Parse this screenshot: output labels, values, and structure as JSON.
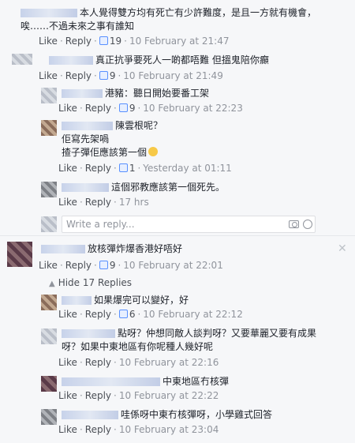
{
  "actions": {
    "like": "Like",
    "reply": "Reply",
    "sep": "·"
  },
  "comments": [
    {
      "text": "本人覺得雙方均有死亡有少許難度，是且一方就有機會，唉……不過未來之事有誰知",
      "likes": "19",
      "time": "10 February at 21:47"
    },
    {
      "text": "真正抗爭要死人一啲都唔難 但搵鬼陪你癲",
      "likes": "9",
      "time": "10 February at 21:49"
    },
    {
      "text": "港豬：聽日開始要番工架",
      "likes": "9",
      "time": "10 February at 22:23"
    },
    {
      "text_lines": [
        "陳雲根呢？",
        "佢寫先架喎",
        "揸子彈佢應該第一個"
      ],
      "likes": "1",
      "time": "Yesterday at 01:11"
    },
    {
      "text": "這個邪教應該第一個死先。",
      "time": "17 hrs"
    },
    {
      "text": "放核彈炸爆香港好唔好",
      "likes": "9",
      "time": "10 February at 22:01"
    },
    {
      "text": "如果爆完可以變好，好",
      "likes": "6",
      "time": "10 February at 22:12"
    },
    {
      "text_lines": [
        "點呀？仲想同敵人談判呀？又要華麗又要有成果",
        "呀？如果中東地區有你呢種人幾好呢"
      ],
      "time": "10 February at 22:16"
    },
    {
      "text": "中東地區冇核彈",
      "time": "10 February at 22:22"
    },
    {
      "text": "哇係呀中東冇核彈呀，小學雞式回答",
      "time": "10 February at 23:04"
    }
  ],
  "reply_box": {
    "placeholder": "Write a reply..."
  },
  "hide_replies": "Hide 17 Replies"
}
